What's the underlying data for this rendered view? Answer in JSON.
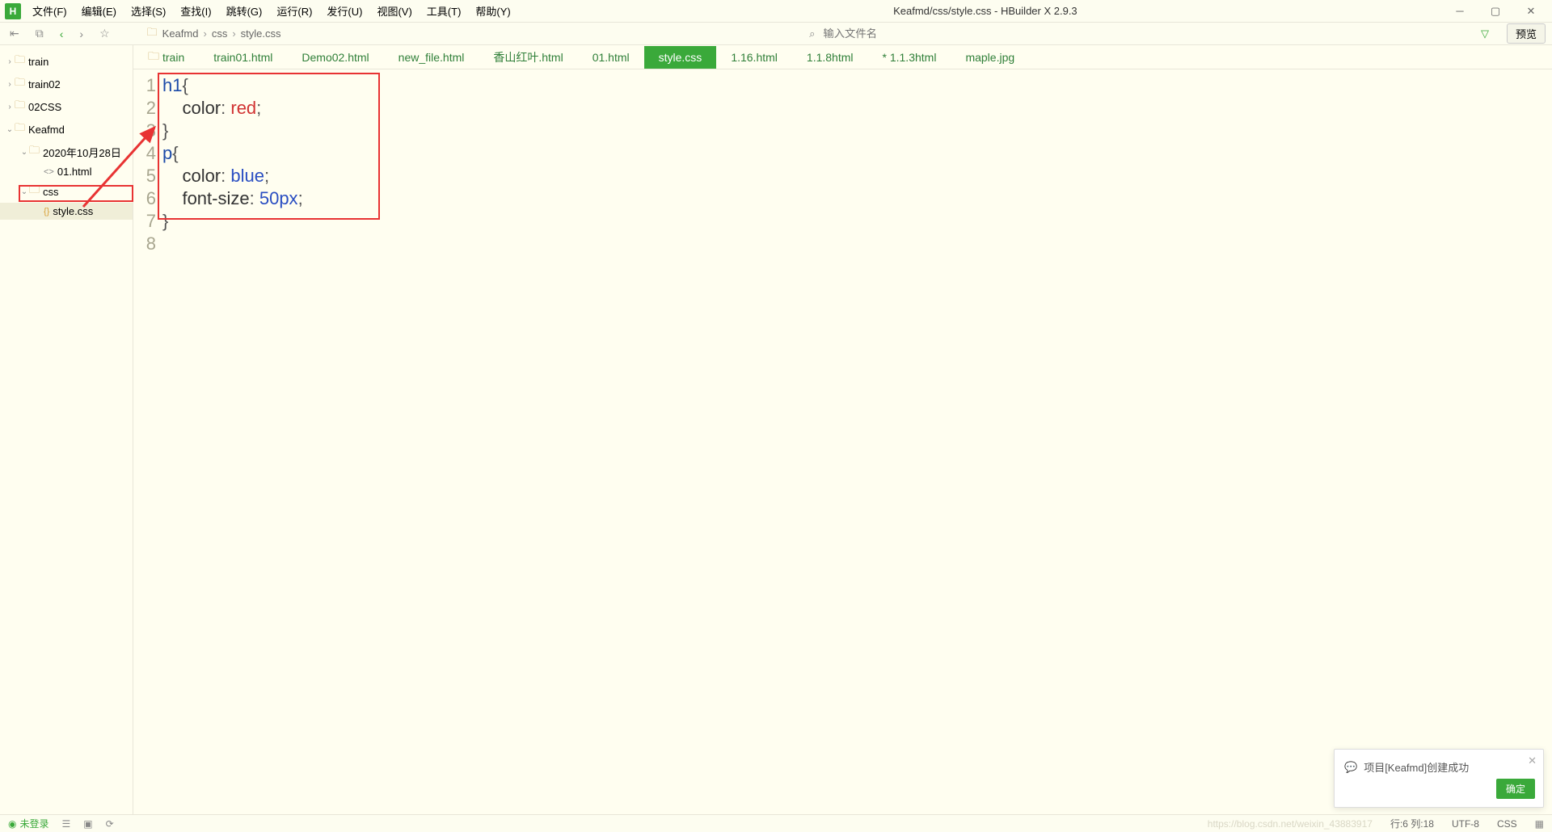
{
  "window": {
    "title": "Keafmd/css/style.css - HBuilder X 2.9.3",
    "logo": "H"
  },
  "menus": [
    "文件(F)",
    "编辑(E)",
    "选择(S)",
    "查找(I)",
    "跳转(G)",
    "运行(R)",
    "发行(U)",
    "视图(V)",
    "工具(T)",
    "帮助(Y)"
  ],
  "breadcrumb": [
    "Keafmd",
    "css",
    "style.css"
  ],
  "search_placeholder": "输入文件名",
  "preview_label": "预览",
  "sidebar": {
    "items": [
      {
        "type": "folder",
        "label": "train",
        "indent": 0,
        "expand": "›"
      },
      {
        "type": "folder",
        "label": "train02",
        "indent": 0,
        "expand": "›"
      },
      {
        "type": "folder",
        "label": "02CSS",
        "indent": 0,
        "expand": "›"
      },
      {
        "type": "folder",
        "label": "Keafmd",
        "indent": 0,
        "expand": "⌄"
      },
      {
        "type": "folder",
        "label": "2020年10月28日",
        "indent": 1,
        "expand": "⌄"
      },
      {
        "type": "html",
        "label": "01.html",
        "indent": 2,
        "expand": ""
      },
      {
        "type": "folder",
        "label": "css",
        "indent": 1,
        "expand": "⌄"
      },
      {
        "type": "css",
        "label": "style.css",
        "indent": 2,
        "expand": "",
        "sel": true
      }
    ]
  },
  "tabs": [
    {
      "label": "train",
      "folder": true
    },
    {
      "label": "train01.html"
    },
    {
      "label": "Demo02.html"
    },
    {
      "label": "new_file.html"
    },
    {
      "label": "香山红叶.html"
    },
    {
      "label": "01.html"
    },
    {
      "label": "style.css",
      "active": true
    },
    {
      "label": "1.16.html"
    },
    {
      "label": "1.1.8html"
    },
    {
      "label": "* 1.1.3html"
    },
    {
      "label": "maple.jpg"
    }
  ],
  "code": {
    "lines": [
      [
        {
          "cls": "sel-text",
          "t": "h1"
        },
        {
          "cls": "punct",
          "t": "{"
        }
      ],
      [
        {
          "cls": "",
          "t": "    "
        },
        {
          "cls": "prop",
          "t": "color"
        },
        {
          "cls": "punct",
          "t": ": "
        },
        {
          "cls": "val-red",
          "t": "red"
        },
        {
          "cls": "punct",
          "t": ";"
        }
      ],
      [
        {
          "cls": "punct",
          "t": "}"
        }
      ],
      [
        {
          "cls": "sel-text",
          "t": "p"
        },
        {
          "cls": "punct",
          "t": "{"
        }
      ],
      [
        {
          "cls": "",
          "t": "    "
        },
        {
          "cls": "prop",
          "t": "color"
        },
        {
          "cls": "punct",
          "t": ": "
        },
        {
          "cls": "val-blue",
          "t": "blue"
        },
        {
          "cls": "punct",
          "t": ";"
        }
      ],
      [
        {
          "cls": "",
          "t": "    "
        },
        {
          "cls": "prop",
          "t": "font-size"
        },
        {
          "cls": "punct",
          "t": ": "
        },
        {
          "cls": "val-num",
          "t": "50px"
        },
        {
          "cls": "punct",
          "t": ";"
        }
      ],
      [
        {
          "cls": "punct",
          "t": "}"
        }
      ],
      []
    ]
  },
  "status": {
    "user": "未登录",
    "pos": "行:6  列:18",
    "encoding": "UTF-8",
    "lang": "CSS",
    "watermark": "https://blog.csdn.net/weixin_43883917"
  },
  "notif": {
    "text": "项目[Keafmd]创建成功",
    "ok": "确定"
  }
}
